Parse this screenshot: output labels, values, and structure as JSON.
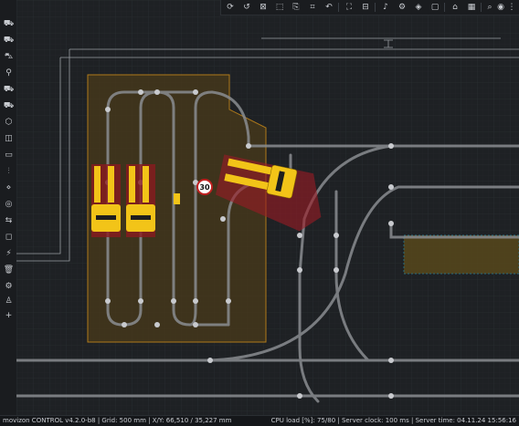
{
  "app": {
    "name": "movizon CONTROL"
  },
  "status": {
    "left": "movizon CONTROL v4.2.0-b8 | Grid: 500 mm | X/Y: 66,510 / 35,227 mm",
    "right": "CPU load [%]: 75/80 | Server clock: 100 ms | Server time: 04.11.24 15:56:16"
  },
  "map": {
    "speed_sign_value": "30"
  },
  "colors": {
    "background": "#1e2124",
    "grid": "#2b2f33",
    "track": "#8a8d91",
    "zone_fill": "#4a3a1a",
    "zone_border": "#b07a1a",
    "vehicle_yellow": "#f2c418",
    "safety_field": "#9b1b25"
  },
  "toolbar_icons": [
    "refresh-icon",
    "rotate-icon",
    "fit-icon",
    "select-icon",
    "route-icon",
    "frame-icon",
    "undo-icon",
    "fullscreen-icon",
    "bell-icon",
    "settings-icon",
    "layers-icon",
    "home-icon",
    "calendar-icon",
    "search-icon",
    "user-icon",
    "more-icon"
  ],
  "sidebar_icons": [
    "vehicle-icon",
    "truck-icon",
    "forklift-icon",
    "agv-icon",
    "bike-icon",
    "car-icon",
    "trailer-icon",
    "box-icon",
    "box-outline-icon",
    "connection-icon",
    "battery-icon",
    "path-icon",
    "node-icon",
    "settings-icon",
    "link-icon",
    "area-icon",
    "trash-icon",
    "charger-icon",
    "plus-icon"
  ]
}
